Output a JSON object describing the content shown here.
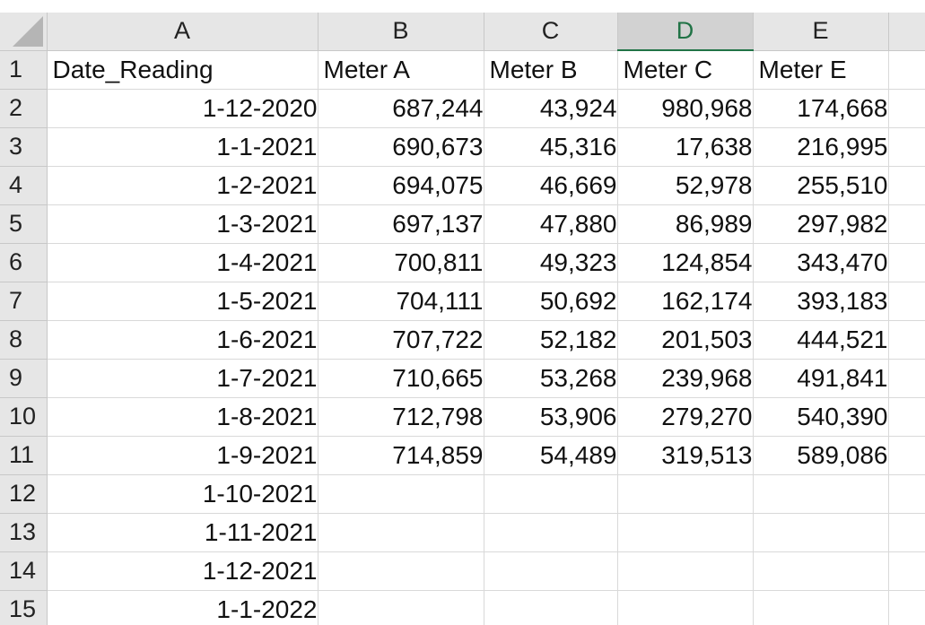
{
  "sheet": {
    "column_headers": [
      "A",
      "B",
      "C",
      "D",
      "E"
    ],
    "selected_column": "D",
    "header_row": [
      "Date_Reading",
      "Meter A",
      "Meter B",
      "Meter C",
      "Meter E"
    ],
    "rows": [
      {
        "num": "1",
        "cells": [
          "Date_Reading",
          "Meter A",
          "Meter B",
          "Meter C",
          "Meter E"
        ]
      },
      {
        "num": "2",
        "cells": [
          "1-12-2020",
          "687,244",
          "43,924",
          "980,968",
          "174,668"
        ]
      },
      {
        "num": "3",
        "cells": [
          "1-1-2021",
          "690,673",
          "45,316",
          "17,638",
          "216,995"
        ]
      },
      {
        "num": "4",
        "cells": [
          "1-2-2021",
          "694,075",
          "46,669",
          "52,978",
          "255,510"
        ]
      },
      {
        "num": "5",
        "cells": [
          "1-3-2021",
          "697,137",
          "47,880",
          "86,989",
          "297,982"
        ]
      },
      {
        "num": "6",
        "cells": [
          "1-4-2021",
          "700,811",
          "49,323",
          "124,854",
          "343,470"
        ]
      },
      {
        "num": "7",
        "cells": [
          "1-5-2021",
          "704,111",
          "50,692",
          "162,174",
          "393,183"
        ]
      },
      {
        "num": "8",
        "cells": [
          "1-6-2021",
          "707,722",
          "52,182",
          "201,503",
          "444,521"
        ]
      },
      {
        "num": "9",
        "cells": [
          "1-7-2021",
          "710,665",
          "53,268",
          "239,968",
          "491,841"
        ]
      },
      {
        "num": "10",
        "cells": [
          "1-8-2021",
          "712,798",
          "53,906",
          "279,270",
          "540,390"
        ]
      },
      {
        "num": "11",
        "cells": [
          "1-9-2021",
          "714,859",
          "54,489",
          "319,513",
          "589,086"
        ]
      },
      {
        "num": "12",
        "cells": [
          "1-10-2021",
          "",
          "",
          "",
          ""
        ]
      },
      {
        "num": "13",
        "cells": [
          "1-11-2021",
          "",
          "",
          "",
          ""
        ]
      },
      {
        "num": "14",
        "cells": [
          "1-12-2021",
          "",
          "",
          "",
          ""
        ]
      },
      {
        "num": "15",
        "cells": [
          "1-1-2022",
          "",
          "",
          "",
          ""
        ]
      }
    ]
  },
  "colors": {
    "header_bg": "#e6e6e6",
    "selected_header_bg": "#d2d2d2",
    "selected_accent": "#217346",
    "gridline": "#d9d9d9"
  },
  "icons": {
    "corner": "select-all-icon"
  }
}
